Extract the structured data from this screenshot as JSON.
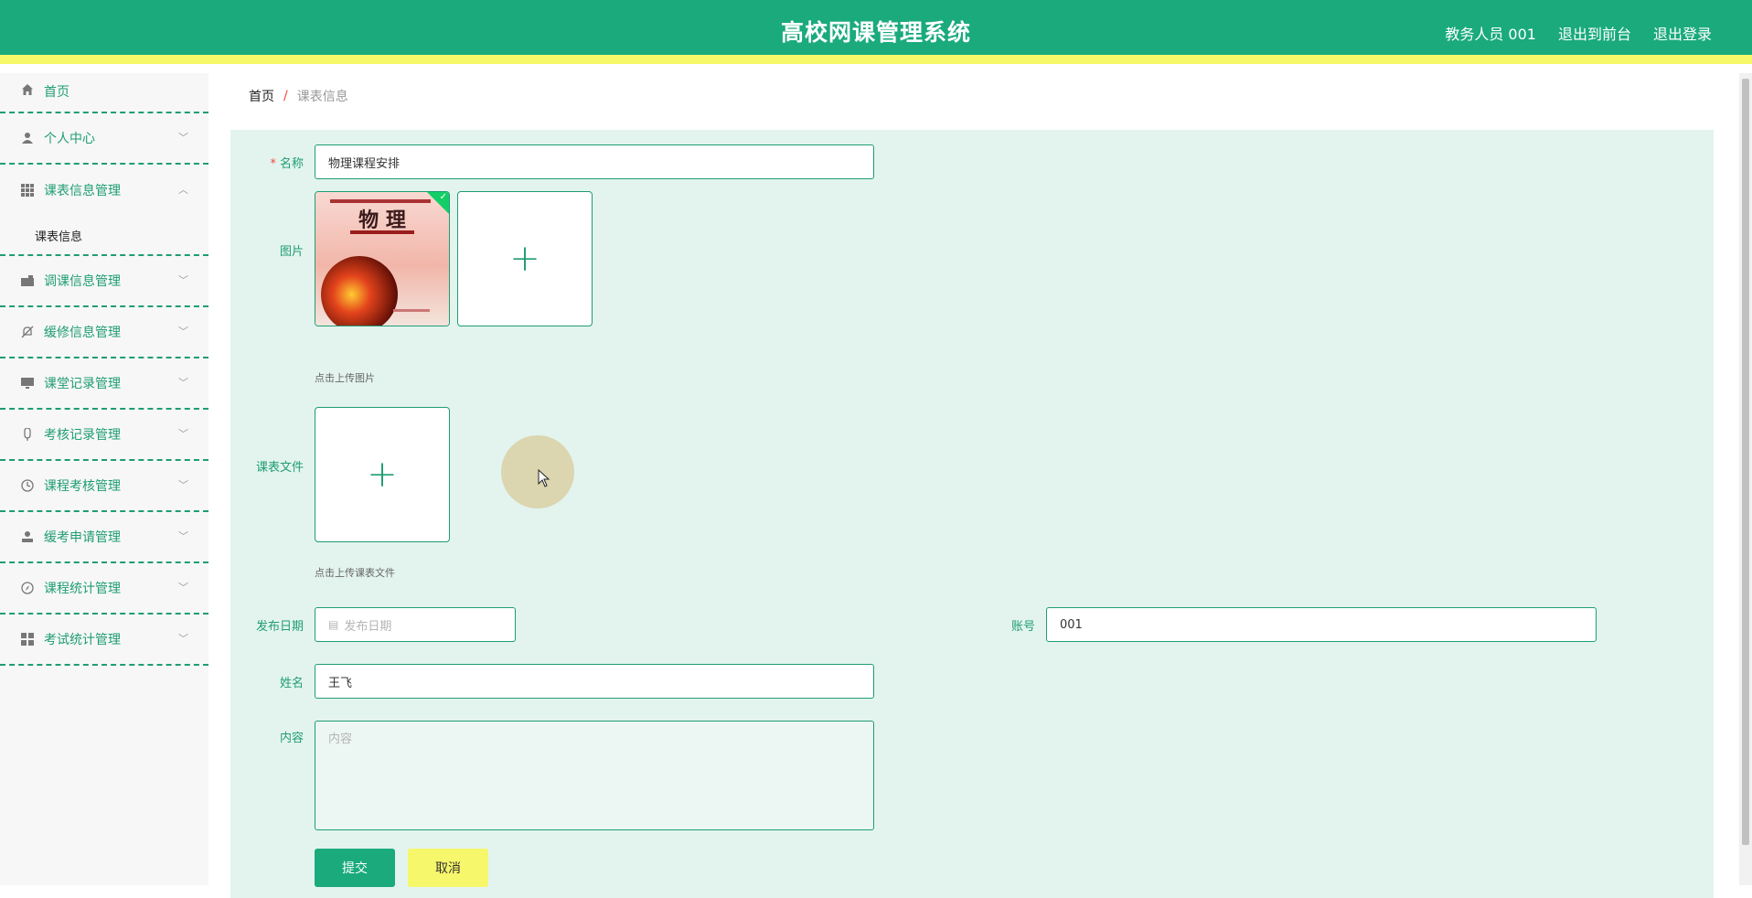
{
  "header": {
    "title": "高校网课管理系统",
    "user": "教务人员 001",
    "to_front": "退出到前台",
    "logout": "退出登录"
  },
  "sidebar": {
    "items": [
      {
        "label": "首页",
        "icon": "home-icon"
      },
      {
        "label": "个人中心",
        "icon": "user-icon"
      },
      {
        "label": "课表信息管理",
        "icon": "grid-icon",
        "expanded": true,
        "children": [
          "课表信息"
        ]
      },
      {
        "label": "调课信息管理",
        "icon": "wallet-icon"
      },
      {
        "label": "缓修信息管理",
        "icon": "bell-off-icon"
      },
      {
        "label": "课堂记录管理",
        "icon": "monitor-icon"
      },
      {
        "label": "考核记录管理",
        "icon": "mic-icon"
      },
      {
        "label": "课程考核管理",
        "icon": "clock-icon"
      },
      {
        "label": "缓考申请管理",
        "icon": "person-icon"
      },
      {
        "label": "课程统计管理",
        "icon": "compass-icon"
      },
      {
        "label": "考试统计管理",
        "icon": "apps-icon"
      }
    ]
  },
  "breadcrumb": {
    "home": "首页",
    "separator": "/",
    "current": "课表信息"
  },
  "form": {
    "name_label": "名称",
    "name_value": "物理课程安排",
    "image_label": "图片",
    "image_title": "物 理",
    "image_tip": "点击上传图片",
    "file_label": "课表文件",
    "file_tip": "点击上传课表文件",
    "date_label": "发布日期",
    "date_placeholder": "发布日期",
    "account_label": "账号",
    "account_value": "001",
    "person_label": "姓名",
    "person_value": "王飞",
    "content_label": "内容",
    "content_placeholder": "内容",
    "submit": "提交",
    "cancel": "取消"
  },
  "colors": {
    "primary": "#1aaa7c",
    "accent": "#f6f86a",
    "form_bg": "#e3f4ee"
  }
}
